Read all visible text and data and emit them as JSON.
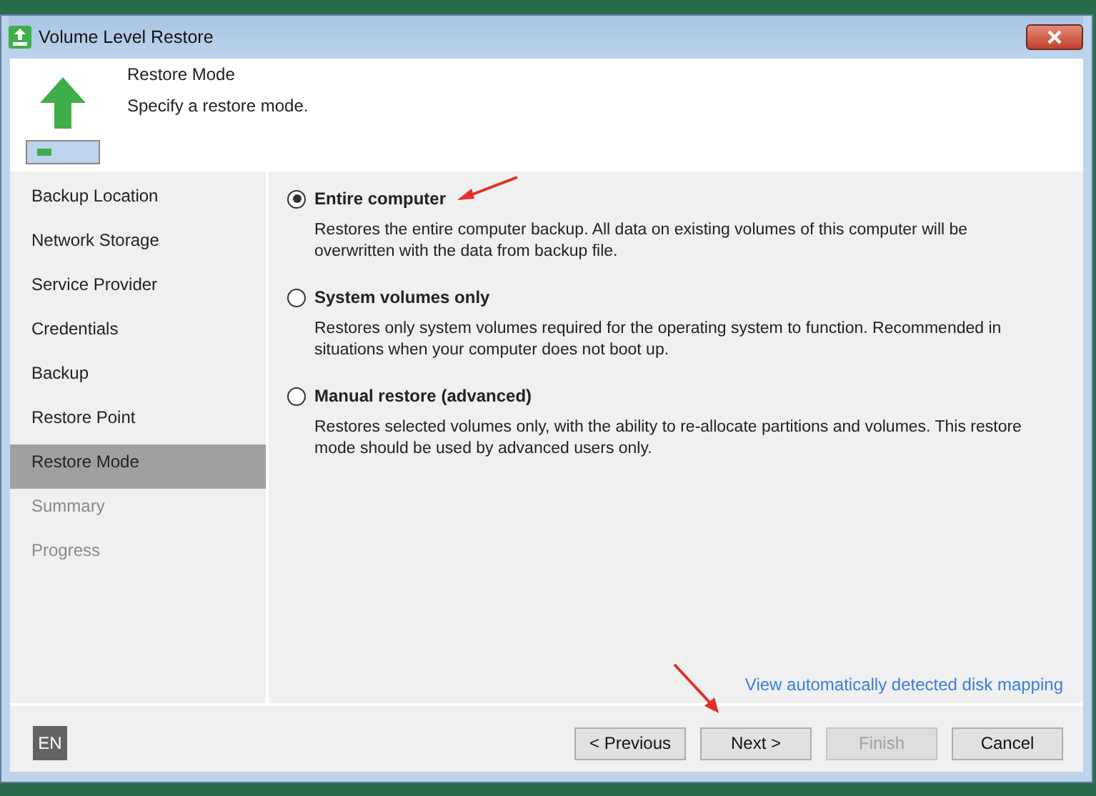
{
  "window": {
    "title": "Volume Level Restore"
  },
  "header": {
    "title": "Restore Mode",
    "subtitle": "Specify a restore mode."
  },
  "steps": [
    {
      "label": "Backup Location",
      "selected": false,
      "disabled": false
    },
    {
      "label": "Network Storage",
      "selected": false,
      "disabled": false
    },
    {
      "label": "Service Provider",
      "selected": false,
      "disabled": false
    },
    {
      "label": "Credentials",
      "selected": false,
      "disabled": false
    },
    {
      "label": "Backup",
      "selected": false,
      "disabled": false
    },
    {
      "label": "Restore Point",
      "selected": false,
      "disabled": false
    },
    {
      "label": "Restore Mode",
      "selected": true,
      "disabled": false
    },
    {
      "label": "Summary",
      "selected": false,
      "disabled": true
    },
    {
      "label": "Progress",
      "selected": false,
      "disabled": true
    }
  ],
  "options": [
    {
      "label": "Entire computer",
      "description": "Restores the entire computer backup. All data on existing volumes of this computer will be overwritten with the data from backup file.",
      "selected": true
    },
    {
      "label": "System volumes only",
      "description": "Restores only system volumes required for the operating system to function. Recommended in situations when your computer does not boot up.",
      "selected": false
    },
    {
      "label": "Manual restore (advanced)",
      "description": "Restores selected volumes only, with the ability to re-allocate partitions and volumes. This restore mode should be used by advanced users only.",
      "selected": false
    }
  ],
  "link": "View automatically detected disk mapping",
  "language": "EN",
  "buttons": [
    {
      "label": "< Previous",
      "disabled": false
    },
    {
      "label": "Next >",
      "disabled": false
    },
    {
      "label": "Finish",
      "disabled": true
    },
    {
      "label": "Cancel",
      "disabled": false
    }
  ]
}
